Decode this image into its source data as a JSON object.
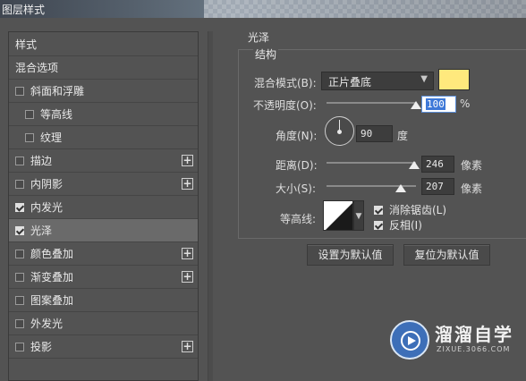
{
  "window": {
    "title": "图层样式"
  },
  "sidebar": {
    "items": [
      {
        "label": "样式",
        "checkbox": false,
        "checked": false,
        "plus": false,
        "indent": false,
        "selected": false
      },
      {
        "label": "混合选项",
        "checkbox": false,
        "checked": false,
        "plus": false,
        "indent": false,
        "selected": false
      },
      {
        "label": "斜面和浮雕",
        "checkbox": true,
        "checked": false,
        "plus": false,
        "indent": false,
        "selected": false
      },
      {
        "label": "等高线",
        "checkbox": true,
        "checked": false,
        "plus": false,
        "indent": true,
        "selected": false
      },
      {
        "label": "纹理",
        "checkbox": true,
        "checked": false,
        "plus": false,
        "indent": true,
        "selected": false
      },
      {
        "label": "描边",
        "checkbox": true,
        "checked": false,
        "plus": true,
        "indent": false,
        "selected": false
      },
      {
        "label": "内阴影",
        "checkbox": true,
        "checked": false,
        "plus": true,
        "indent": false,
        "selected": false
      },
      {
        "label": "内发光",
        "checkbox": true,
        "checked": true,
        "plus": false,
        "indent": false,
        "selected": false
      },
      {
        "label": "光泽",
        "checkbox": true,
        "checked": true,
        "plus": false,
        "indent": false,
        "selected": true
      },
      {
        "label": "颜色叠加",
        "checkbox": true,
        "checked": false,
        "plus": true,
        "indent": false,
        "selected": false
      },
      {
        "label": "渐变叠加",
        "checkbox": true,
        "checked": false,
        "plus": true,
        "indent": false,
        "selected": false
      },
      {
        "label": "图案叠加",
        "checkbox": true,
        "checked": false,
        "plus": false,
        "indent": false,
        "selected": false
      },
      {
        "label": "外发光",
        "checkbox": true,
        "checked": false,
        "plus": false,
        "indent": false,
        "selected": false
      },
      {
        "label": "投影",
        "checkbox": true,
        "checked": false,
        "plus": true,
        "indent": false,
        "selected": false
      }
    ]
  },
  "satin": {
    "group_title": "光泽",
    "section_title": "结构",
    "blend_mode": {
      "label": "混合模式(B):",
      "value": "正片叠底",
      "color": "#ffe97d"
    },
    "opacity": {
      "label": "不透明度(O):",
      "value": "100",
      "unit": "%",
      "level": 100
    },
    "angle": {
      "label": "角度(N):",
      "value": "90",
      "unit": "度"
    },
    "distance": {
      "label": "距离(D):",
      "value": "246",
      "unit": "像素",
      "level": 246
    },
    "size": {
      "label": "大小(S):",
      "value": "207",
      "unit": "像素",
      "level": 207
    },
    "contour": {
      "label": "等高线:"
    },
    "anti_alias": {
      "label": "消除锯齿(L)",
      "checked": true
    },
    "invert": {
      "label": "反相(I)",
      "checked": true
    },
    "make_default": "设置为默认值",
    "reset_default": "复位为默认值"
  },
  "watermark": {
    "name": "溜溜自学",
    "url": "ZIXUE.3066.COM"
  }
}
